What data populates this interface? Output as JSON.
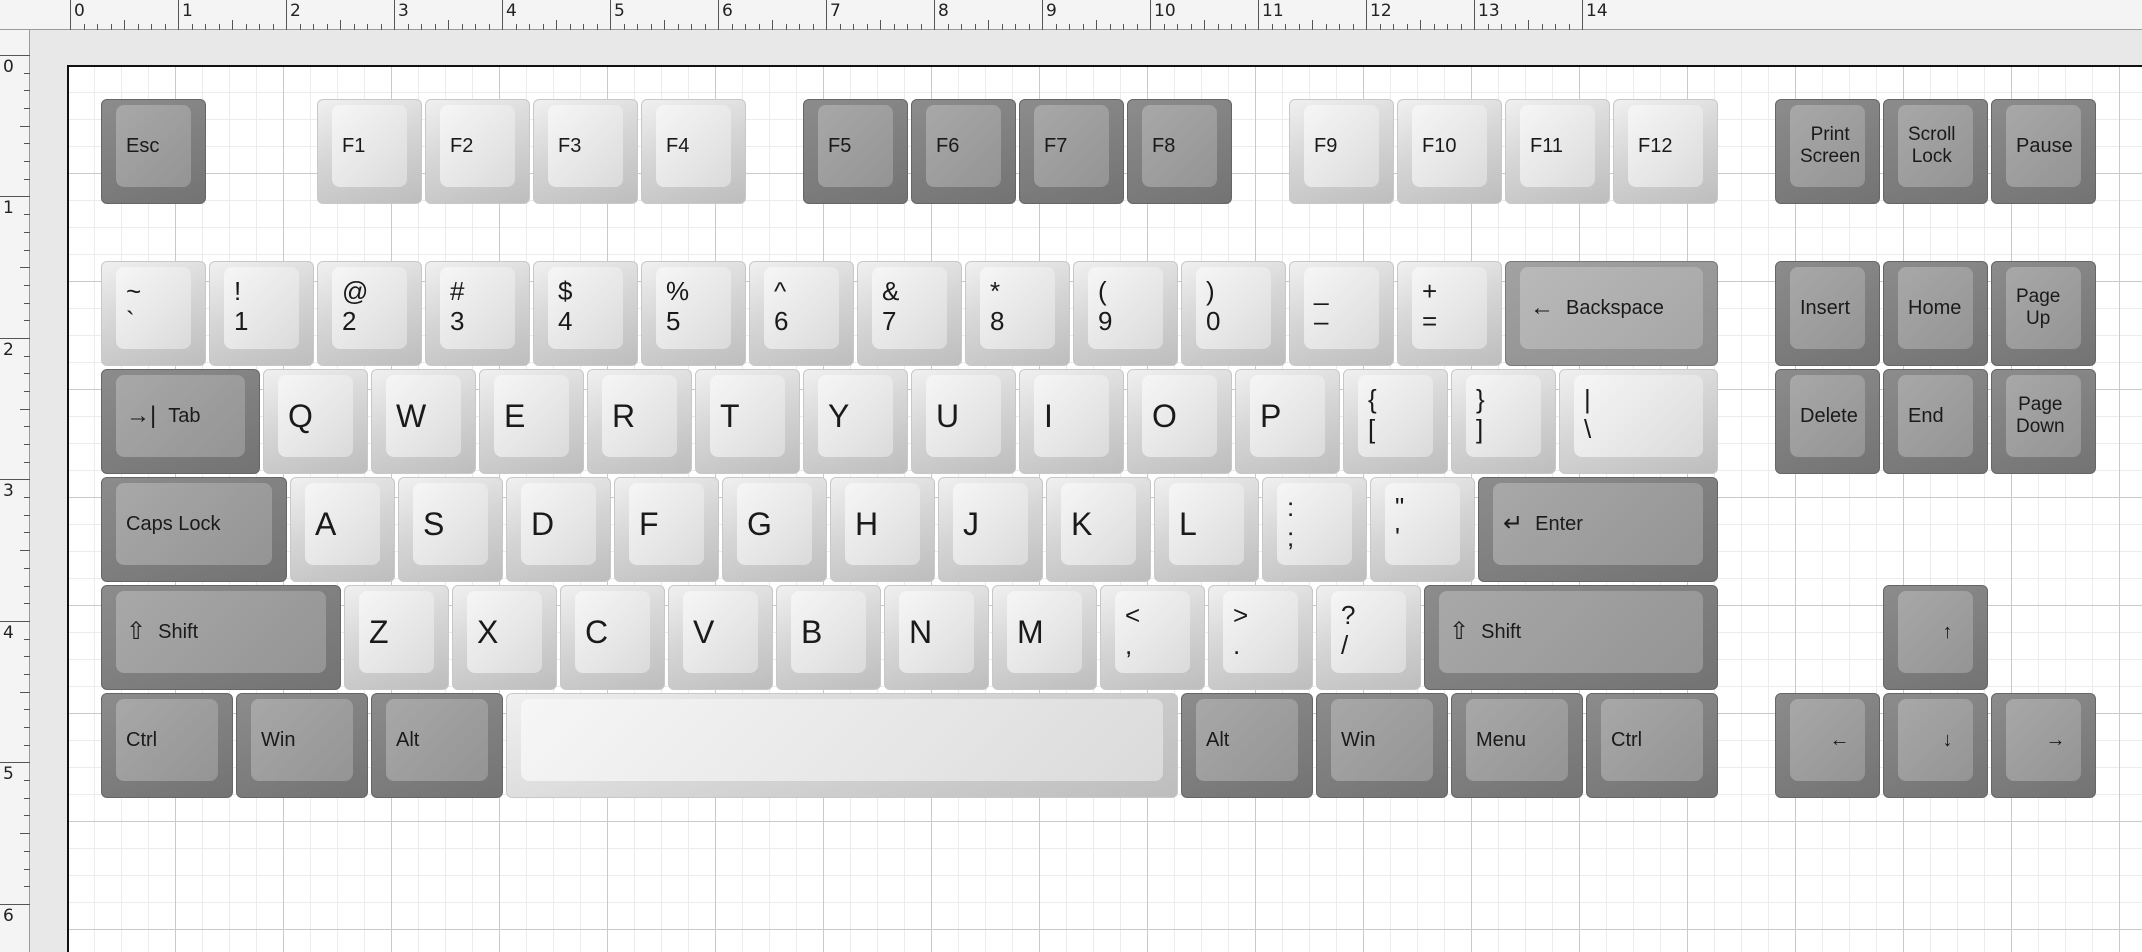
{
  "ruler": {
    "top_numbers": [
      "0",
      "1",
      "2",
      "3",
      "4",
      "5",
      "6",
      "7",
      "8",
      "9",
      "10",
      "11",
      "12",
      "13",
      "14"
    ],
    "left_numbers": [
      "0",
      "1",
      "2",
      "3",
      "4",
      "5",
      "6"
    ]
  },
  "keyboard": {
    "function_row": {
      "esc": "Esc",
      "f1": "F1",
      "f2": "F2",
      "f3": "F3",
      "f4": "F4",
      "f5": "F5",
      "f6": "F6",
      "f7": "F7",
      "f8": "F8",
      "f9": "F9",
      "f10": "F10",
      "f11": "F11",
      "f12": "F12",
      "print_screen": [
        "Print",
        "Screen"
      ],
      "scroll_lock": [
        "Scroll",
        "Lock"
      ],
      "pause": "Pause"
    },
    "number_row": [
      {
        "top": "~",
        "bottom": "`"
      },
      {
        "top": "!",
        "bottom": "1"
      },
      {
        "top": "@",
        "bottom": "2"
      },
      {
        "top": "#",
        "bottom": "3"
      },
      {
        "top": "$",
        "bottom": "4"
      },
      {
        "top": "%",
        "bottom": "5"
      },
      {
        "top": "^",
        "bottom": "6"
      },
      {
        "top": "&",
        "bottom": "7"
      },
      {
        "top": "*",
        "bottom": "8"
      },
      {
        "top": "(",
        "bottom": "9"
      },
      {
        "top": ")",
        "bottom": "0"
      },
      {
        "top": "_",
        "bottom": "–"
      },
      {
        "top": "+",
        "bottom": "="
      }
    ],
    "backspace": "Backspace",
    "tab": "Tab",
    "qwerty_letters": [
      "Q",
      "W",
      "E",
      "R",
      "T",
      "Y",
      "U",
      "I",
      "O",
      "P"
    ],
    "bracket_keys": [
      {
        "top": "{",
        "bottom": "["
      },
      {
        "top": "}",
        "bottom": "]"
      },
      {
        "top": "|",
        "bottom": "\\"
      }
    ],
    "caps_lock": "Caps Lock",
    "home_letters": [
      "A",
      "S",
      "D",
      "F",
      "G",
      "H",
      "J",
      "K",
      "L"
    ],
    "home_punct": [
      {
        "top": ":",
        "bottom": ";"
      },
      {
        "top": "\"",
        "bottom": "'"
      }
    ],
    "enter": "Enter",
    "shift_left": "Shift",
    "bottom_letters": [
      "Z",
      "X",
      "C",
      "V",
      "B",
      "N",
      "M"
    ],
    "bottom_punct": [
      {
        "top": "<",
        "bottom": ","
      },
      {
        "top": ">",
        "bottom": "."
      },
      {
        "top": "?",
        "bottom": "/"
      }
    ],
    "shift_right": "Shift",
    "ctrl_left": "Ctrl",
    "win_left": "Win",
    "alt_left": "Alt",
    "alt_right": "Alt",
    "win_right": "Win",
    "menu": "Menu",
    "ctrl_right": "Ctrl",
    "nav": {
      "insert": "Insert",
      "home": "Home",
      "page_up": [
        "Page",
        "Up"
      ],
      "delete": "Delete",
      "end": "End",
      "page_down": [
        "Page",
        "Down"
      ]
    },
    "arrows": {
      "up": "↑",
      "left": "←",
      "down": "↓",
      "right": "→"
    },
    "icons": {
      "backspace": "←",
      "tab": "→|",
      "enter": "↵",
      "shift": "⇧"
    }
  }
}
